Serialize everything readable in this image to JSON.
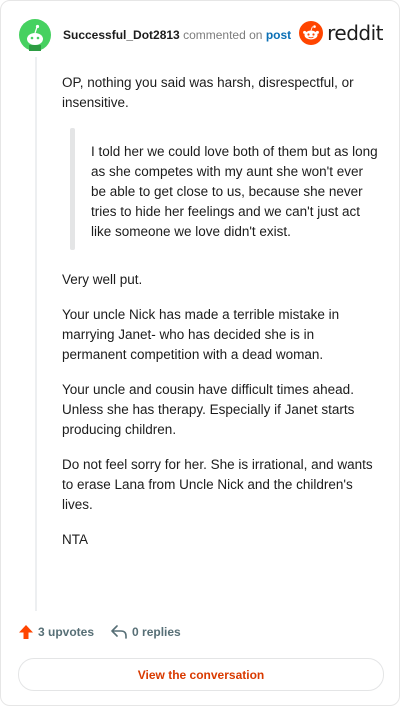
{
  "header": {
    "username": "Successful_Dot2813",
    "meta_text": "commented on",
    "post_link": "post",
    "logo_text": "reddit"
  },
  "comment": {
    "intro": "OP, nothing you said was harsh, disrespectful, or insensitive.",
    "quote": "I told her we could love both of them but as long as she competes with my aunt she won't ever be able to get close to us, because she never tries to hide her feelings and we can't just act like someone we love didn't exist.",
    "paragraphs": [
      "Very well put.",
      "Your uncle Nick has made a terrible mistake in marrying Janet- who has decided she is in permanent competition with a dead woman.",
      "Your uncle and cousin have difficult times ahead. Unless she has therapy. Especially if Janet starts producing children.",
      "Do not feel sorry for her. She is irrational, and wants to erase Lana from Uncle Nick and the children's lives.",
      "NTA"
    ]
  },
  "footer": {
    "upvotes": "3 upvotes",
    "replies": "0 replies",
    "view_button": "View the conversation"
  },
  "colors": {
    "avatar": "#46d160",
    "brand": "#ff4500",
    "upvote": "#ff4500",
    "link": "#0a6fb5",
    "button_text": "#d93a00"
  },
  "icons": {
    "avatar": "snoo-avatar-icon",
    "logo": "reddit-logo-icon",
    "upvote": "upvote-arrow-icon",
    "reply": "reply-arrow-icon"
  }
}
